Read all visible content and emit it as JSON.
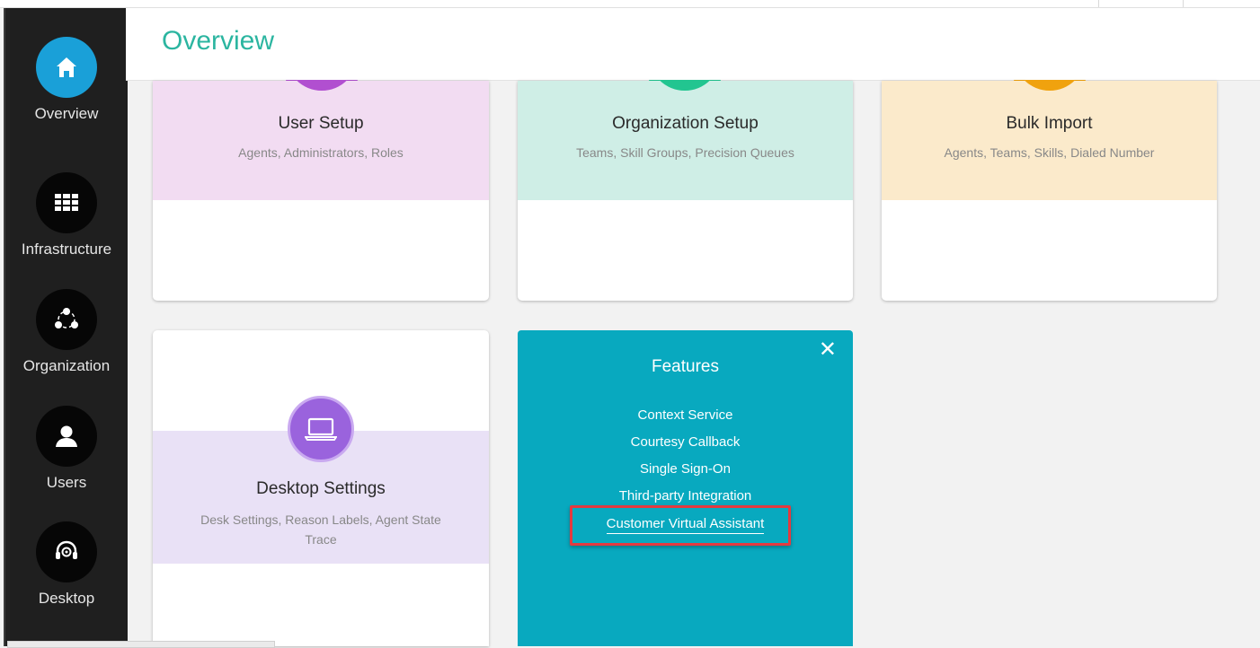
{
  "header": {
    "title": "Overview"
  },
  "sidebar": {
    "items": [
      {
        "label": "Overview",
        "icon": "home-icon",
        "active": true
      },
      {
        "label": "Infrastructure",
        "icon": "grid-icon",
        "active": false
      },
      {
        "label": "Organization",
        "icon": "network-icon",
        "active": false
      },
      {
        "label": "Users",
        "icon": "user-icon",
        "active": false
      },
      {
        "label": "Desktop",
        "icon": "headset-gear-icon",
        "active": false
      }
    ]
  },
  "cards": {
    "user_setup": {
      "title": "User Setup",
      "subtitle": "Agents, Administrators, Roles",
      "color": "#f2dcf2"
    },
    "org_setup": {
      "title": "Organization Setup",
      "subtitle": "Teams, Skill Groups, Precision Queues",
      "color": "#cfeee6"
    },
    "bulk_import": {
      "title": "Bulk Import",
      "subtitle": "Agents, Teams, Skills, Dialed Number",
      "color": "#fbeacb"
    },
    "desktop_settings": {
      "title": "Desktop Settings",
      "subtitle_line1": "Desk Settings, Reason Labels, Agent State",
      "subtitle_line2": "Trace",
      "color": "#e9e1f6"
    }
  },
  "features": {
    "title": "Features",
    "close_icon": "close-icon",
    "links": [
      "Context Service",
      "Courtesy Callback",
      "Single Sign-On",
      "Third-party Integration",
      "Customer Virtual Assistant"
    ],
    "highlight_color": "#e43a3f",
    "bg_color": "#08a9bf"
  },
  "colors": {
    "accent_title": "#2bb5a0",
    "nav_active": "#1aa0d8",
    "sidebar_bg": "#1f1f1f"
  }
}
